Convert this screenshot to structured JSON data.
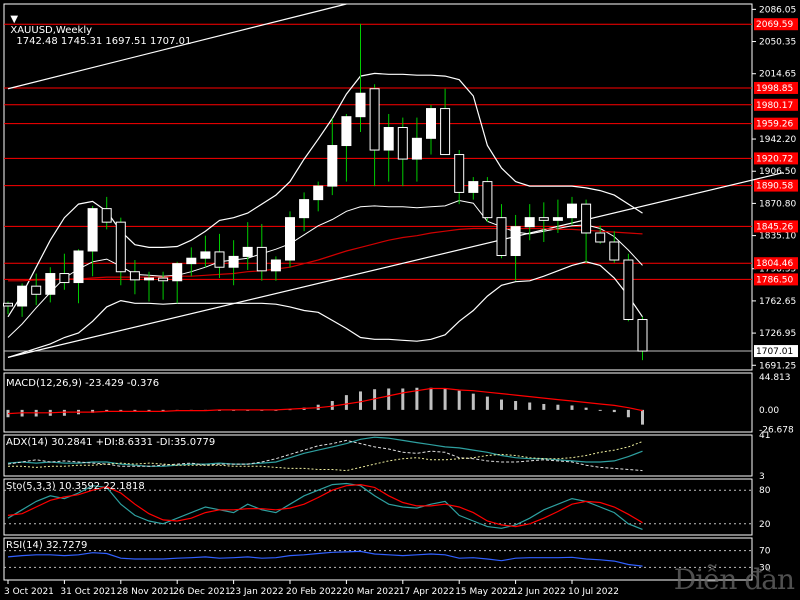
{
  "header": {
    "symbol": "XAUUSD,Weekly",
    "ohlc": "1742.48 1745.31 1697.51 1707.01"
  },
  "indicators": {
    "macd_label": "MACD(12,26,9) -23.429 -0.376",
    "adx_label": "ADX(14) 30.2841 +DI:8.6331 -DI:35.0779",
    "sto_label": "Sto(5,3,3) 10.3592 22.1818",
    "rsi_label": "RSI(14) 32.7279"
  },
  "watermark": "Diễn đàn",
  "colors": {
    "background": "#000000",
    "bull_candle": "#ffffff",
    "bear_candle": "#000000",
    "wick": "#00cc00",
    "level_line": "#ff0000",
    "level_label_bg": "#ff0000",
    "price_label_bg": "#ffffff",
    "band": "#ffffff",
    "ma_red": "#d00000",
    "histogram": "#c0c0c0",
    "signal_red": "#ff0000",
    "adx_cyan": "#2ea0a0",
    "sto_main": "#2ea0a0",
    "rsi_blue": "#3060ff"
  },
  "chart_data": [
    {
      "type": "candlestick",
      "title": "XAUUSD,Weekly",
      "y_ticks": [
        "2086.05",
        "2050.35",
        "2014.65",
        "1942.20",
        "1906.50",
        "1870.80",
        "1835.10",
        "1798.35",
        "1762.65",
        "1726.95",
        "1691.25"
      ],
      "ylim": [
        1686,
        2092
      ],
      "x_ticks": [
        "3 Oct 2021",
        "31 Oct 2021",
        "28 Nov 2021",
        "26 Dec 2021",
        "23 Jan 2022",
        "20 Feb 2022",
        "20 Mar 2022",
        "17 Apr 2022",
        "15 May 2022",
        "12 Jun 2022",
        "10 Jul 2022"
      ],
      "levels": [
        "2069.59",
        "1998.85",
        "1980.17",
        "1959.26",
        "1920.72",
        "1890.58",
        "1845.26",
        "1804.46",
        "1786.50"
      ],
      "current_price": "1707.01",
      "candles": [
        {
          "o": 1760,
          "h": 1762,
          "l": 1748,
          "c": 1757
        },
        {
          "o": 1757,
          "h": 1782,
          "l": 1745,
          "c": 1779
        },
        {
          "o": 1779,
          "h": 1793,
          "l": 1758,
          "c": 1770
        },
        {
          "o": 1770,
          "h": 1800,
          "l": 1761,
          "c": 1793
        },
        {
          "o": 1793,
          "h": 1815,
          "l": 1775,
          "c": 1783
        },
        {
          "o": 1783,
          "h": 1820,
          "l": 1760,
          "c": 1818
        },
        {
          "o": 1818,
          "h": 1868,
          "l": 1790,
          "c": 1865
        },
        {
          "o": 1865,
          "h": 1878,
          "l": 1842,
          "c": 1850
        },
        {
          "o": 1850,
          "h": 1855,
          "l": 1780,
          "c": 1795
        },
        {
          "o": 1795,
          "h": 1808,
          "l": 1770,
          "c": 1786
        },
        {
          "o": 1786,
          "h": 1795,
          "l": 1762,
          "c": 1788
        },
        {
          "o": 1788,
          "h": 1795,
          "l": 1764,
          "c": 1785
        },
        {
          "o": 1785,
          "h": 1806,
          "l": 1760,
          "c": 1804
        },
        {
          "o": 1804,
          "h": 1822,
          "l": 1790,
          "c": 1810
        },
        {
          "o": 1810,
          "h": 1835,
          "l": 1800,
          "c": 1817
        },
        {
          "o": 1817,
          "h": 1837,
          "l": 1788,
          "c": 1800
        },
        {
          "o": 1800,
          "h": 1830,
          "l": 1780,
          "c": 1812
        },
        {
          "o": 1812,
          "h": 1850,
          "l": 1797,
          "c": 1822
        },
        {
          "o": 1822,
          "h": 1848,
          "l": 1785,
          "c": 1796
        },
        {
          "o": 1796,
          "h": 1812,
          "l": 1785,
          "c": 1808
        },
        {
          "o": 1808,
          "h": 1862,
          "l": 1800,
          "c": 1855
        },
        {
          "o": 1855,
          "h": 1883,
          "l": 1840,
          "c": 1875
        },
        {
          "o": 1875,
          "h": 1895,
          "l": 1862,
          "c": 1890
        },
        {
          "o": 1890,
          "h": 1965,
          "l": 1880,
          "c": 1935
        },
        {
          "o": 1935,
          "h": 1970,
          "l": 1895,
          "c": 1967
        },
        {
          "o": 1967,
          "h": 2070,
          "l": 1950,
          "c": 1993
        },
        {
          "o": 1998,
          "h": 2003,
          "l": 1890,
          "c": 1930
        },
        {
          "o": 1930,
          "h": 1970,
          "l": 1895,
          "c": 1955
        },
        {
          "o": 1955,
          "h": 1966,
          "l": 1890,
          "c": 1920
        },
        {
          "o": 1920,
          "h": 1966,
          "l": 1895,
          "c": 1943
        },
        {
          "o": 1943,
          "h": 1980,
          "l": 1925,
          "c": 1976
        },
        {
          "o": 1976,
          "h": 1998,
          "l": 1925,
          "c": 1925
        },
        {
          "o": 1925,
          "h": 1930,
          "l": 1870,
          "c": 1883
        },
        {
          "o": 1883,
          "h": 1900,
          "l": 1875,
          "c": 1895
        },
        {
          "o": 1895,
          "h": 1900,
          "l": 1850,
          "c": 1855
        },
        {
          "o": 1855,
          "h": 1870,
          "l": 1810,
          "c": 1813
        },
        {
          "o": 1813,
          "h": 1858,
          "l": 1785,
          "c": 1845
        },
        {
          "o": 1845,
          "h": 1870,
          "l": 1830,
          "c": 1855
        },
        {
          "o": 1855,
          "h": 1872,
          "l": 1828,
          "c": 1852
        },
        {
          "o": 1852,
          "h": 1875,
          "l": 1838,
          "c": 1855
        },
        {
          "o": 1855,
          "h": 1878,
          "l": 1847,
          "c": 1870
        },
        {
          "o": 1870,
          "h": 1875,
          "l": 1805,
          "c": 1838
        },
        {
          "o": 1838,
          "h": 1846,
          "l": 1826,
          "c": 1828
        },
        {
          "o": 1828,
          "h": 1840,
          "l": 1805,
          "c": 1808
        },
        {
          "o": 1808,
          "h": 1815,
          "l": 1740,
          "c": 1742
        },
        {
          "o": 1742,
          "h": 1745,
          "l": 1697,
          "c": 1707
        }
      ],
      "upper_band": [
        1745,
        1770,
        1800,
        1830,
        1855,
        1870,
        1873,
        1862,
        1840,
        1825,
        1822,
        1822,
        1823,
        1830,
        1840,
        1852,
        1855,
        1860,
        1870,
        1880,
        1895,
        1920,
        1942,
        1965,
        1992,
        2012,
        2015,
        2014,
        2014,
        2013,
        2013,
        2012,
        2008,
        1990,
        1935,
        1910,
        1895,
        1890,
        1890,
        1890,
        1890,
        1888,
        1885,
        1880,
        1870,
        1860
      ],
      "lower_band": [
        1700,
        1705,
        1710,
        1715,
        1722,
        1727,
        1740,
        1756,
        1763,
        1760,
        1760,
        1759,
        1760,
        1760,
        1760,
        1760,
        1760,
        1760,
        1760,
        1759,
        1756,
        1752,
        1750,
        1741,
        1732,
        1722,
        1720,
        1720,
        1719,
        1718,
        1720,
        1725,
        1740,
        1752,
        1768,
        1780,
        1784,
        1785,
        1790,
        1796,
        1802,
        1806,
        1802,
        1788,
        1768,
        1745
      ],
      "middle_line": [
        1722,
        1737,
        1755,
        1772,
        1788,
        1798,
        1806,
        1809,
        1801,
        1792,
        1791,
        1790,
        1791,
        1795,
        1800,
        1806,
        1808,
        1810,
        1815,
        1820,
        1826,
        1836,
        1846,
        1853,
        1862,
        1867,
        1868,
        1867,
        1867,
        1866,
        1867,
        1868,
        1874,
        1871,
        1851,
        1845,
        1839,
        1837,
        1840,
        1843,
        1846,
        1847,
        1843,
        1834,
        1819,
        1802
      ],
      "ma_red": [
        1785,
        1785,
        1786,
        1786,
        1787,
        1787,
        1788,
        1789,
        1789,
        1789,
        1789,
        1789,
        1790,
        1790,
        1791,
        1792,
        1793,
        1795,
        1796,
        1798,
        1800,
        1804,
        1808,
        1813,
        1818,
        1822,
        1826,
        1830,
        1833,
        1835,
        1838,
        1840,
        1842,
        1843,
        1843,
        1843,
        1843,
        1843,
        1843,
        1842,
        1842,
        1841,
        1840,
        1839,
        1838,
        1837
      ],
      "trendline_support": {
        "from": {
          "i": 0,
          "v": 1700
        },
        "to": {
          "i": 55,
          "v": 1905
        }
      },
      "trendline_resistance": {
        "from": {
          "i": 0,
          "v": 1998
        },
        "to": {
          "i": 24,
          "v": 2092
        }
      }
    },
    {
      "type": "bar",
      "title": "MACD(12,26,9) -23.429 -0.376",
      "y_ticks": [
        "44.813",
        "0.00",
        "-26.678"
      ],
      "ylim": [
        -30,
        50
      ],
      "values": [
        -10,
        -9,
        -9,
        -8,
        -8,
        -6,
        -4,
        -2,
        -1,
        -1,
        -1,
        -1,
        -1,
        -0.5,
        0,
        0,
        0,
        0,
        0,
        0,
        1,
        3,
        7,
        12,
        20,
        25,
        28,
        29,
        29,
        30,
        30,
        29,
        26,
        22,
        18,
        14,
        12,
        10,
        8,
        7,
        6,
        3,
        0,
        -3,
        -10,
        -20
      ],
      "signal": [
        -5,
        -4,
        -4,
        -4,
        -3,
        -3,
        -3,
        -2,
        -2,
        -2,
        -2,
        -2,
        -1,
        -1,
        -1,
        0,
        0,
        0,
        0,
        0,
        1,
        2,
        3,
        5,
        8,
        11,
        15,
        19,
        23,
        26,
        29,
        29,
        27,
        26,
        24,
        22,
        20,
        18,
        16,
        14,
        12,
        10,
        8,
        6,
        3,
        -1
      ]
    },
    {
      "type": "line",
      "title": "ADX(14) 30.2841 +DI:8.6331 -DI:35.0779",
      "y_ticks": [
        "41",
        "3"
      ],
      "ylim": [
        3,
        41
      ],
      "series": [
        {
          "name": "ADX",
          "values": [
            15,
            16,
            15,
            16,
            15,
            15,
            16,
            16,
            14,
            13,
            12,
            12,
            13,
            14,
            14,
            15,
            14,
            14,
            15,
            16,
            20,
            24,
            27,
            30,
            33,
            37,
            39,
            38,
            36,
            34,
            32,
            30,
            29,
            27,
            25,
            22,
            20,
            19,
            19,
            18,
            17,
            16,
            16,
            17,
            21,
            26
          ]
        },
        {
          "name": "+DI",
          "values": [
            14,
            16,
            18,
            16,
            17,
            16,
            15,
            14,
            12,
            12,
            12,
            13,
            14,
            15,
            13,
            14,
            14,
            14,
            16,
            19,
            23,
            27,
            31,
            33,
            36,
            33,
            30,
            28,
            25,
            24,
            26,
            25,
            20,
            19,
            17,
            16,
            16,
            17,
            18,
            17,
            16,
            13,
            11,
            10,
            9,
            8
          ]
        },
        {
          "name": "-DI",
          "values": [
            12,
            12,
            11,
            12,
            12,
            13,
            13,
            14,
            15,
            14,
            15,
            14,
            13,
            13,
            13,
            13,
            12,
            12,
            12,
            11,
            10,
            10,
            9,
            9,
            8,
            11,
            14,
            17,
            19,
            20,
            18,
            18,
            19,
            20,
            22,
            23,
            22,
            20,
            19,
            19,
            20,
            22,
            25,
            27,
            30,
            35
          ]
        }
      ]
    },
    {
      "type": "line",
      "title": "Sto(5,3,3) 10.3592 22.1818",
      "y_ticks": [
        "80",
        "20"
      ],
      "ylim": [
        0,
        100
      ],
      "series": [
        {
          "name": "main",
          "values": [
            30,
            45,
            60,
            70,
            65,
            75,
            88,
            85,
            55,
            35,
            25,
            20,
            30,
            40,
            50,
            45,
            40,
            55,
            45,
            40,
            55,
            70,
            80,
            90,
            92,
            88,
            70,
            55,
            50,
            48,
            55,
            60,
            35,
            25,
            15,
            12,
            18,
            30,
            45,
            55,
            65,
            60,
            50,
            40,
            20,
            10
          ]
        },
        {
          "name": "signal",
          "values": [
            35,
            38,
            50,
            62,
            68,
            72,
            80,
            86,
            75,
            55,
            38,
            27,
            25,
            30,
            40,
            45,
            45,
            47,
            47,
            45,
            48,
            55,
            67,
            80,
            88,
            90,
            85,
            70,
            58,
            52,
            52,
            55,
            50,
            40,
            25,
            18,
            15,
            20,
            30,
            42,
            55,
            60,
            58,
            50,
            37,
            22
          ]
        }
      ]
    },
    {
      "type": "line",
      "title": "RSI(14) 32.7279",
      "y_ticks": [
        "70",
        "30"
      ],
      "ylim": [
        0,
        100
      ],
      "series": [
        {
          "name": "RSI",
          "values": [
            55,
            58,
            60,
            60,
            58,
            60,
            65,
            63,
            52,
            50,
            50,
            50,
            52,
            53,
            55,
            52,
            53,
            55,
            52,
            53,
            58,
            60,
            63,
            66,
            67,
            68,
            62,
            60,
            58,
            60,
            62,
            60,
            52,
            53,
            50,
            46,
            52,
            53,
            53,
            53,
            54,
            50,
            48,
            45,
            37,
            33
          ]
        }
      ]
    }
  ]
}
